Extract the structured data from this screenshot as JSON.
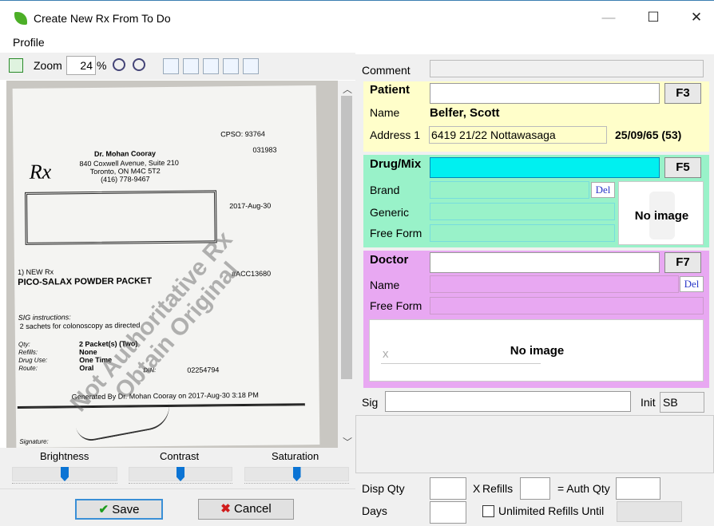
{
  "window": {
    "title": "Create New Rx From To Do",
    "minimize": "—",
    "maximize": "☐",
    "close": "✕"
  },
  "menu": {
    "profile": "Profile"
  },
  "toolbar": {
    "zoom_label": "Zoom",
    "zoom_value": "24",
    "zoom_unit": "%"
  },
  "document": {
    "cpso": "CPSO: 93764",
    "code": "031983",
    "rx": "Rx",
    "doctor_name": "Dr. Mohan Cooray",
    "addr1": "840 Coxwell Avenue, Suite 210",
    "addr2": "Toronto, ON  M4C 5T2",
    "phone": "(416) 778-9467",
    "date": "2017-Aug-30",
    "new_rx": "1) NEW Rx",
    "drug": "PICO-SALAX POWDER PACKET",
    "acc": "#ACC13680",
    "sig_label": "SIG instructions:",
    "sig_text": "2 sachets for colonoscopy as directed",
    "qty_label": "Qty:",
    "qty_value": "2 Packet(s) (Two)",
    "refills_label": "Refills:",
    "refills_value": "None",
    "druguse_label": "Drug Use:",
    "druguse_value": "One Time",
    "route_label": "Route:",
    "route_value": "Oral",
    "din_label": "DIN:",
    "din_value": "02254794",
    "generated": "Generated By Dr. Mohan Cooray on 2017-Aug-30 3:18 PM",
    "signature_label": "Signature:",
    "watermark1": "Not Authoritative Rx",
    "watermark2": "Obtain Original"
  },
  "sliders": [
    {
      "label": "Brightness",
      "level": 0.5
    },
    {
      "label": "Contrast",
      "level": 0.5
    },
    {
      "label": "Saturation",
      "level": 0.5
    }
  ],
  "buttons": {
    "save": "Save",
    "cancel": "Cancel"
  },
  "form": {
    "comment_label": "Comment",
    "comment_value": "",
    "patient": {
      "header": "Patient",
      "search_value": "",
      "fkey": "F3",
      "name_label": "Name",
      "name_value": "Belfer, Scott",
      "address_label": "Address 1",
      "address_value": "6419 21/22 Nottawasaga",
      "dob": "25/09/65 (53)"
    },
    "drug": {
      "header": "Drug/Mix",
      "search_value": "",
      "fkey": "F5",
      "brand_label": "Brand",
      "generic_label": "Generic",
      "freeform_label": "Free Form",
      "del": "Del",
      "no_image": "No image"
    },
    "doctor": {
      "header": "Doctor",
      "search_value": "",
      "fkey": "F7",
      "name_label": "Name",
      "freeform_label": "Free Form",
      "del": "Del",
      "no_image": "No image",
      "sig_x": "x"
    },
    "sig_label": "Sig",
    "sig_value": "",
    "init_label": "Init",
    "init_value": "SB",
    "disp_qty_label": "Disp Qty",
    "refills_label": "Refills",
    "refills_x": "X",
    "auth_qty_label": "= Auth Qty",
    "days_label": "Days",
    "unlimited_label": "Unlimited Refills Until"
  },
  "colors": {
    "patient_bg": "#fffeca",
    "drug_bg": "#99f2c9",
    "drug_field": "#00f0f0",
    "doctor_bg": "#e8a8f2",
    "accent": "#0b74d4"
  }
}
